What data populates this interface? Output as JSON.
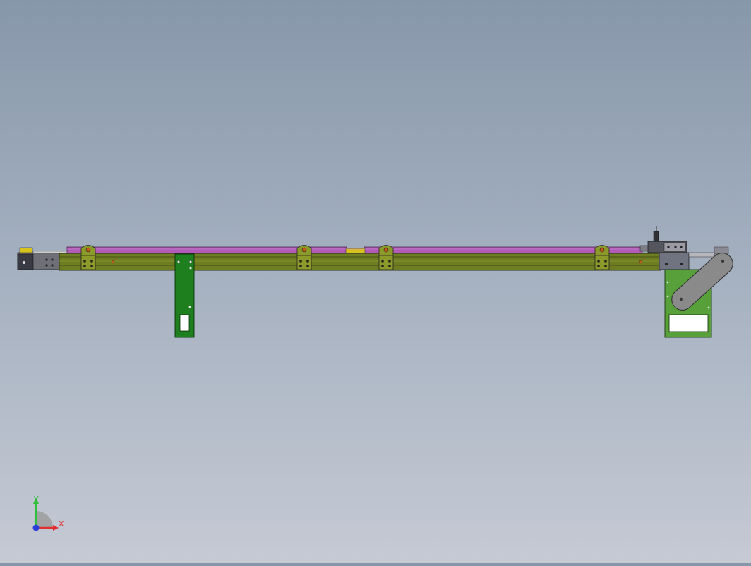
{
  "viewport": {
    "background_top": "#8797aa",
    "background_bottom": "#c5cad4"
  },
  "model": {
    "rail_color": "#6e7d22",
    "belt_color": "#b15bb8",
    "bracket_color": "#8c9a2a",
    "stand_color": "#1d7f1d",
    "motor_plate_color": "#58a13a",
    "motor_cover_color": "#8a8a8a",
    "accent_yellow": "#d8c21e",
    "hole_color": "#c05a1a"
  },
  "triad": {
    "x_label": "X",
    "y_label": "Y",
    "x_color": "#e23030",
    "y_color": "#2fbf3a",
    "z_color": "#2a3fd8",
    "icon": "coordinate-triad-icon"
  }
}
